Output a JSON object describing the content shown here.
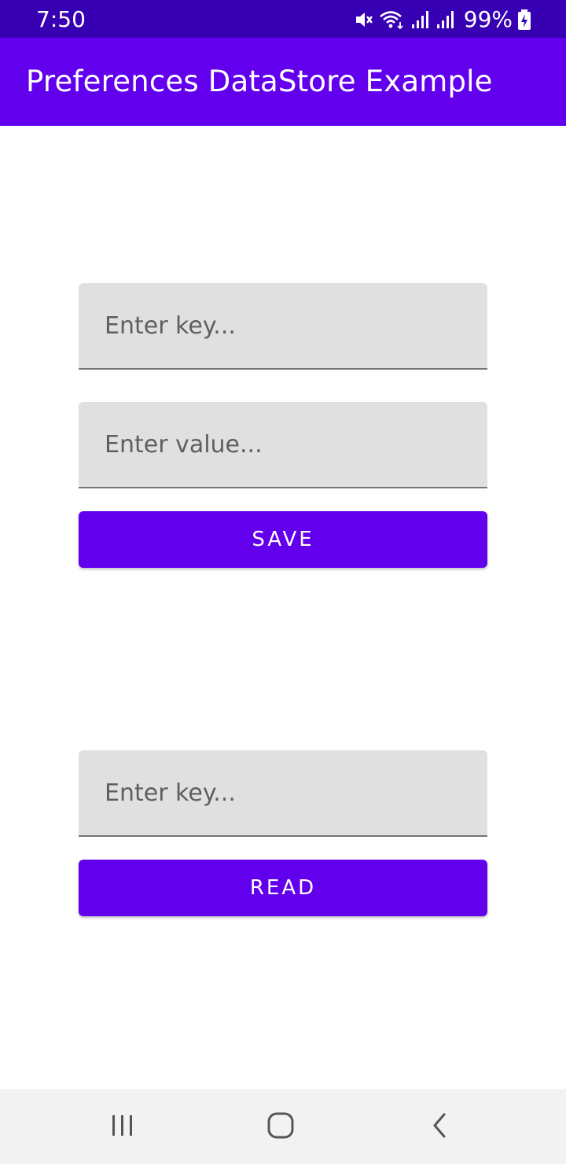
{
  "status_bar": {
    "time": "7:50",
    "battery": "99%",
    "icons": [
      "mute-icon",
      "wifi-icon",
      "signal-icon",
      "signal-icon-2",
      "battery-charging-icon"
    ]
  },
  "app_bar": {
    "title": "Preferences DataStore Example"
  },
  "save_section": {
    "key_placeholder": "Enter key...",
    "value_placeholder": "Enter value...",
    "save_label": "SAVE"
  },
  "read_section": {
    "key_placeholder": "Enter key...",
    "read_label": "READ"
  },
  "nav_bar": {
    "items": [
      "recents-icon",
      "home-icon",
      "back-icon"
    ]
  },
  "colors": {
    "primary": "#6200ee",
    "primary_dark": "#3700b3",
    "field_bg": "#e0e0e0",
    "nav_bg": "#f2f2f2"
  }
}
